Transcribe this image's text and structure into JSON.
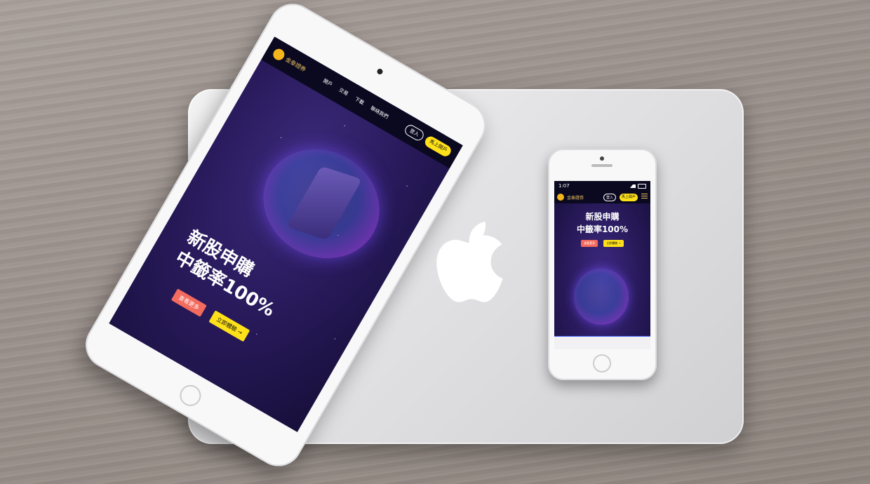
{
  "ipad": {
    "logo_text": "金泰證券",
    "nav": [
      "開戶",
      "交易",
      "下載",
      "聯絡我們"
    ],
    "login": "登入",
    "open_account": "馬上開戶",
    "headline_line1": "新股申購",
    "headline_line2": "中籤率100%",
    "btn_primary": "查看更多",
    "btn_secondary": "立即體驗 →"
  },
  "iphone": {
    "time": "1:07",
    "logo_text": "金泰證券",
    "login": "登入",
    "open_account": "馬上開戶",
    "headline_line1": "新股申購",
    "headline_line2": "中籤率100%",
    "btn_primary": "查看更多",
    "btn_secondary": "立即體驗 →"
  }
}
